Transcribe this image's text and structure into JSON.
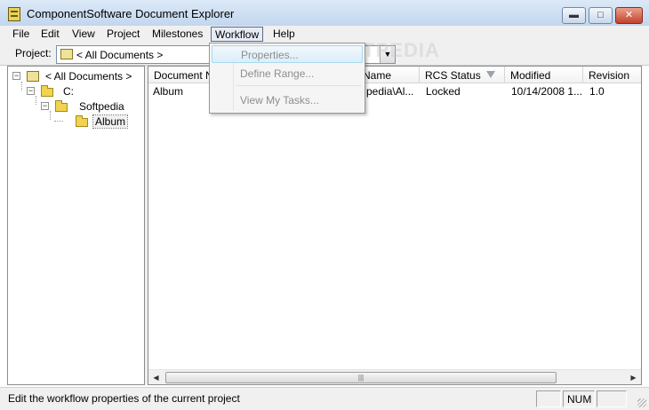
{
  "window": {
    "title": "ComponentSoftware Document Explorer",
    "min_glyph": "▬",
    "max_glyph": "□",
    "close_glyph": "✕"
  },
  "menu": {
    "file": "File",
    "edit": "Edit",
    "view": "View",
    "project": "Project",
    "milestones": "Milestones",
    "workflow": "Workflow",
    "help": "Help"
  },
  "workflow_menu": {
    "properties": "Properties...",
    "define_range": "Define Range...",
    "view_my_tasks": "View My Tasks..."
  },
  "toolbar": {
    "project_label": "Project:",
    "project_value": "< All Documents >"
  },
  "tree": {
    "root": "< All Documents >",
    "drive": "C:",
    "folder": "Softpedia",
    "subfolder": "Album"
  },
  "list": {
    "columns": {
      "document_name": "Document Name",
      "name": "Name",
      "rcs_status": "RCS Status",
      "modified": "Modified",
      "revision": "Revision"
    },
    "rows": [
      {
        "document_name": "Album",
        "name": "pedia\\Al...",
        "rcs_status": "Locked",
        "modified": "10/14/2008 1...",
        "revision": "1.0"
      }
    ]
  },
  "watermark": "SOFTPEDIA",
  "status": {
    "message": "Edit the workflow properties of the current project",
    "num": "NUM"
  },
  "colors": {
    "menu_highlight": "#e6ecf6",
    "hover_item": "#daeefa",
    "disabled_text": "#8d8d8d"
  }
}
